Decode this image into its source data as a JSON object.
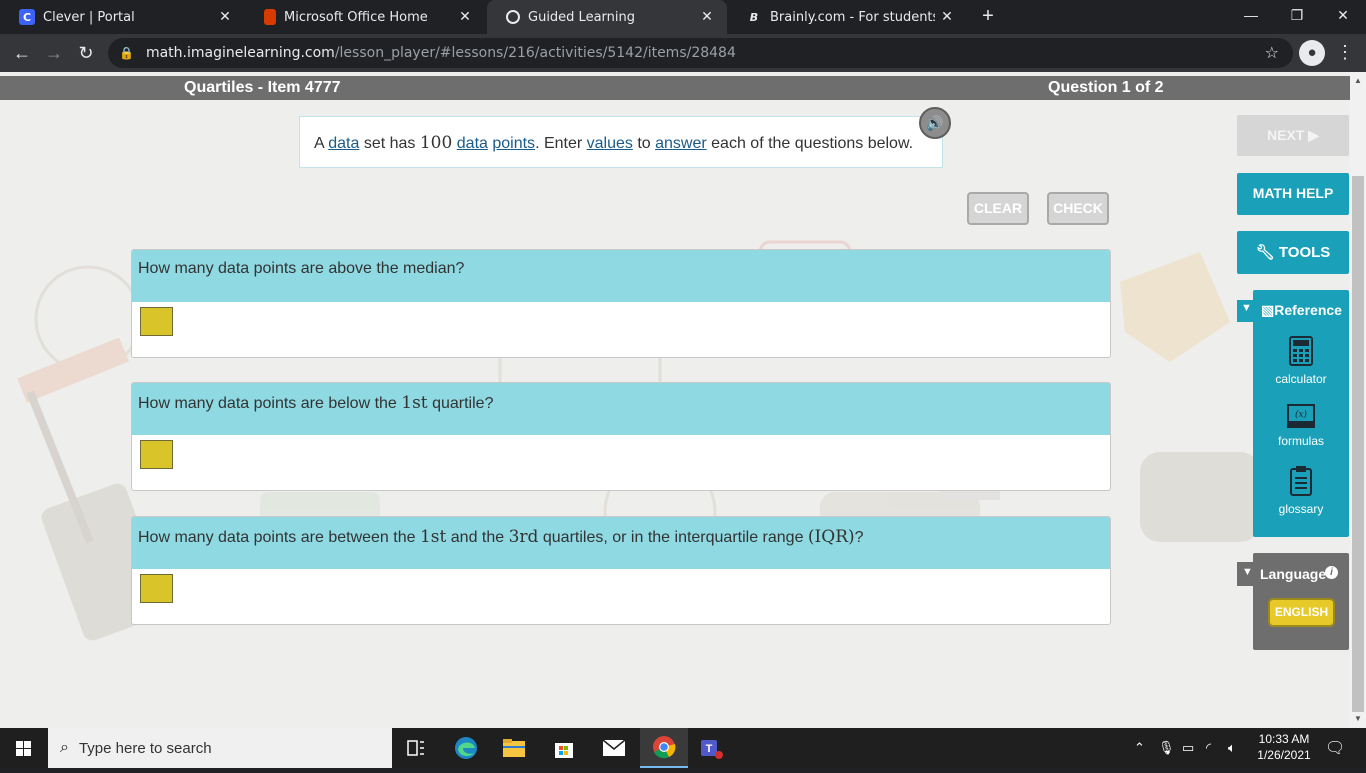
{
  "browser": {
    "tabs": [
      {
        "title": "Clever | Portal",
        "favicon": "C",
        "favicon_color": "#3c63f6"
      },
      {
        "title": "Microsoft Office Home",
        "favicon": "O",
        "favicon_color": "#d83b01"
      },
      {
        "title": "Guided Learning",
        "favicon": "globe-icon",
        "favicon_color": "#e8eaed"
      },
      {
        "title": "Brainly.com - For students. By stu",
        "favicon": "B",
        "favicon_color": "#202124"
      }
    ],
    "url_host": "math.imaginelearning.com",
    "url_path": "/lesson_player/#lessons/216/activities/5142/items/28484"
  },
  "lesson": {
    "title": "Quartiles - Item 4777",
    "progress": "Question 1 of 2",
    "prompt": {
      "p1": "A ",
      "w_data": "data",
      "p2": " set has ",
      "num": "100",
      "w_data2": "data",
      "w_points": "points",
      "p3": ". Enter ",
      "w_values": "values",
      "p4": " to ",
      "w_answer": "answer",
      "p5": " each of the questions below."
    },
    "clear_label": "CLEAR",
    "check_label": "CHECK",
    "questions": [
      {
        "a": "How many data points are above the median?"
      },
      {
        "a": "How many data points are below the ",
        "m1": "1st",
        "b": " quartile?"
      },
      {
        "a": "How many data points are between the ",
        "m1": "1st",
        "b": " and the ",
        "m2": "3rd",
        "c": " quartiles, or in the interquartile range ",
        "m3": "(IQR)",
        "d": "?"
      }
    ]
  },
  "sidebar": {
    "next_label": "NEXT ▶",
    "math_help_label": "MATH HELP",
    "tools_label": "TOOLS",
    "reference_label": "Reference",
    "reference_items": [
      {
        "label": "calculator",
        "icon": "calculator-icon"
      },
      {
        "label": "formulas",
        "icon": "formulas-icon"
      },
      {
        "label": "glossary",
        "icon": "clipboard-icon"
      }
    ],
    "language_label": "Language",
    "language_button": "ENGLISH"
  },
  "taskbar": {
    "search_placeholder": "Type here to search",
    "time": "10:33 AM",
    "date": "1/26/2021"
  },
  "colors": {
    "accent": "#1aa0b8",
    "question_header": "#8ed9e2",
    "answer_box": "#d9c42a"
  }
}
